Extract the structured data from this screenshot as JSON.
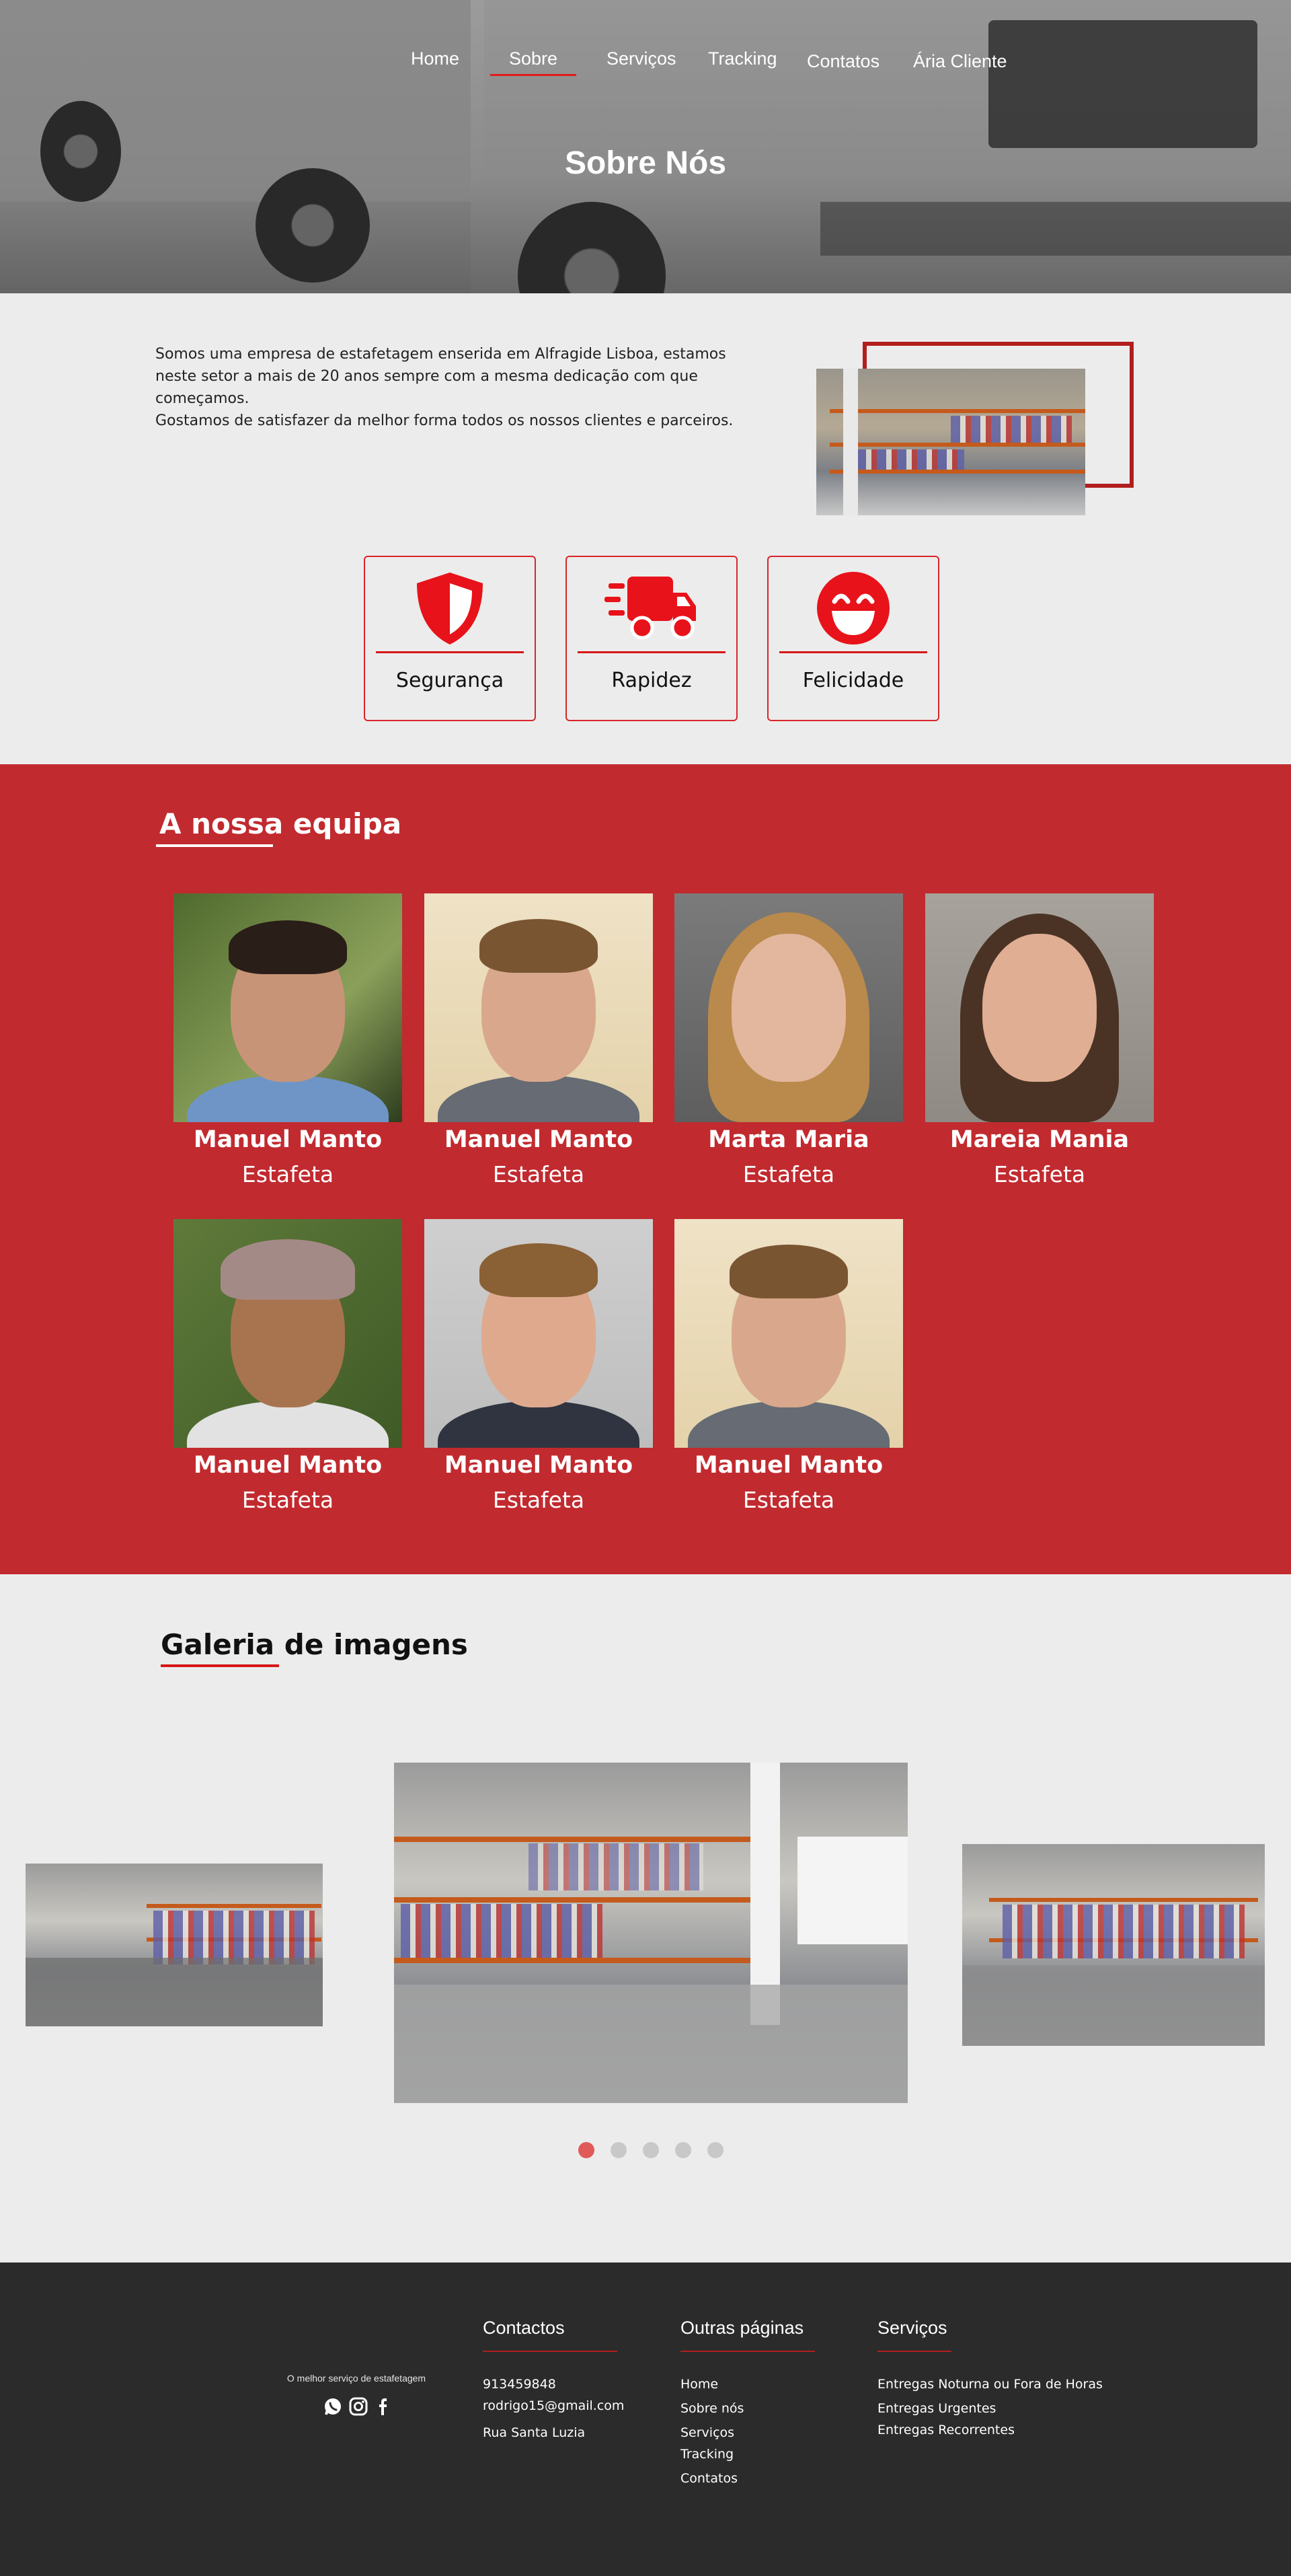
{
  "nav": {
    "items": [
      {
        "label": "Home"
      },
      {
        "label": "Sobre"
      },
      {
        "label": "Serviços"
      },
      {
        "label": "Tracking"
      },
      {
        "label": "Contatos"
      },
      {
        "label": "Ária Cliente"
      }
    ],
    "active": "Sobre"
  },
  "hero": {
    "title": "Sobre Nós"
  },
  "about": {
    "paragraph_1": "Somos uma empresa de estafetagem enserida em Alfragide Lisboa, estamos neste setor a mais de 20 anos sempre com a mesma dedicação com que começamos.",
    "paragraph_2": "Gostamos de satisfazer da melhor forma todos os nossos clientes e parceiros."
  },
  "features": [
    {
      "label": "Segurança",
      "icon": "shield-icon"
    },
    {
      "label": "Rapidez",
      "icon": "delivery-truck-icon"
    },
    {
      "label": "Felicidade",
      "icon": "smiley-face-icon"
    }
  ],
  "team": {
    "title_part1": "A nossa",
    "title_part2": "equipa",
    "members": [
      {
        "name": "Manuel Manto",
        "role": "Estafeta"
      },
      {
        "name": "Manuel Manto",
        "role": "Estafeta"
      },
      {
        "name": "Marta Maria",
        "role": "Estafeta"
      },
      {
        "name": "Mareia Mania",
        "role": "Estafeta"
      },
      {
        "name": "Manuel Manto",
        "role": "Estafeta"
      },
      {
        "name": "Manuel Manto",
        "role": "Estafeta"
      },
      {
        "name": "Manuel Manto",
        "role": "Estafeta"
      }
    ]
  },
  "gallery": {
    "title_part1": "Galeria",
    "title_part2": "de imagens",
    "active_slide": 1,
    "slide_count": 5
  },
  "footer": {
    "tagline": "O melhor serviço de estafetagem",
    "social_icons": [
      "whatsapp-icon",
      "instagram-icon",
      "facebook-icon"
    ],
    "contactos": {
      "title": "Contactos",
      "phone": "913459848",
      "email": "rodrigo15@gmail.com",
      "address": "Rua Santa Luzia"
    },
    "outras_paginas": {
      "title": "Outras páginas",
      "links": [
        "Home",
        "Sobre nós",
        "Serviços",
        "Tracking",
        "Contatos"
      ]
    },
    "servicos": {
      "title": "Serviços",
      "items": [
        "Entregas Noturna ou Fora de Horas",
        "Entregas Urgentes",
        "Entregas Recorrentes"
      ]
    }
  },
  "colors": {
    "accent": "#c12a2f",
    "accent_bright": "#e21b1b",
    "footer_bg": "#2b2b2b",
    "page_bg": "#ececec"
  }
}
